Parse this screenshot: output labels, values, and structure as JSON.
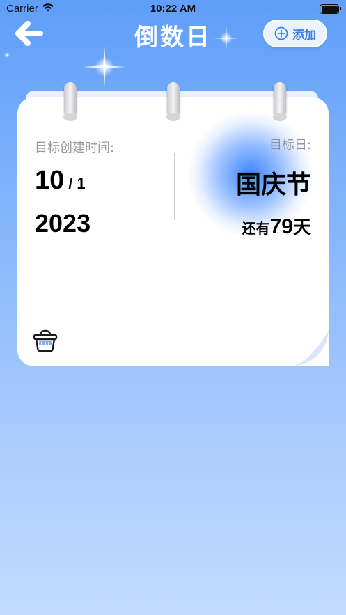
{
  "status_bar": {
    "carrier": "Carrier",
    "time": "10:22 AM"
  },
  "header": {
    "title": "倒数日",
    "add_label": "添加"
  },
  "card": {
    "created_label": "目标创建时间:",
    "created_month": "10",
    "created_separator": "/",
    "created_day": "1",
    "created_year": "2023",
    "target_label": "目标日:",
    "target_name": "国庆节",
    "remaining_prefix": "还有",
    "remaining_days": "79",
    "remaining_suffix": "天"
  },
  "icons": {
    "back": "arrow-left-icon",
    "add": "plus-circle-icon",
    "delete": "trash-basket-icon",
    "wifi": "wifi-icon",
    "battery": "battery-icon"
  },
  "colors": {
    "accent": "#3e7ee8",
    "background_top": "#5f9ef9",
    "background_bottom": "#c3dbff"
  }
}
